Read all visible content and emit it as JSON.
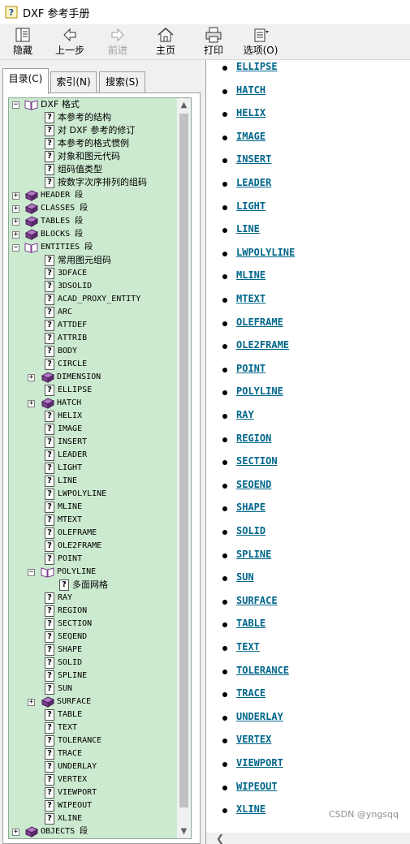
{
  "window": {
    "title": "DXF 参考手册"
  },
  "toolbar": {
    "hide": "隐藏",
    "back": "上一步",
    "forward": "前进",
    "home": "主页",
    "print": "打印",
    "options": "选项(O)"
  },
  "tabs": {
    "contents": "目录(C)",
    "index": "索引(N)",
    "search": "搜索(S)"
  },
  "tree": [
    {
      "label": "DXF 格式",
      "type": "book-open",
      "level": 0,
      "expander": "-"
    },
    {
      "label": "本参考的结构",
      "type": "page",
      "level": 1
    },
    {
      "label": "对 DXF 参考的修订",
      "type": "page",
      "level": 1
    },
    {
      "label": "本参考的格式惯例",
      "type": "page",
      "level": 1
    },
    {
      "label": "对象和图元代码",
      "type": "page",
      "level": 1
    },
    {
      "label": "组码值类型",
      "type": "page",
      "level": 1
    },
    {
      "label": "按数字次序排列的组码",
      "type": "page",
      "level": 1
    },
    {
      "label": "HEADER 段",
      "type": "book",
      "level": 0,
      "expander": "+"
    },
    {
      "label": "CLASSES 段",
      "type": "book",
      "level": 0,
      "expander": "+"
    },
    {
      "label": "TABLES 段",
      "type": "book",
      "level": 0,
      "expander": "+"
    },
    {
      "label": "BLOCKS 段",
      "type": "book",
      "level": 0,
      "expander": "+"
    },
    {
      "label": "ENTITIES 段",
      "type": "book-open",
      "level": 0,
      "expander": "-"
    },
    {
      "label": "常用图元组码",
      "type": "page",
      "level": 1
    },
    {
      "label": "3DFACE",
      "type": "page",
      "level": 1
    },
    {
      "label": "3DSOLID",
      "type": "page",
      "level": 1
    },
    {
      "label": "ACAD_PROXY_ENTITY",
      "type": "page",
      "level": 1
    },
    {
      "label": "ARC",
      "type": "page",
      "level": 1
    },
    {
      "label": "ATTDEF",
      "type": "page",
      "level": 1
    },
    {
      "label": "ATTRIB",
      "type": "page",
      "level": 1
    },
    {
      "label": "BODY",
      "type": "page",
      "level": 1
    },
    {
      "label": "CIRCLE",
      "type": "page",
      "level": 1
    },
    {
      "label": "DIMENSION",
      "type": "book",
      "level": 1,
      "expander": "+"
    },
    {
      "label": "ELLIPSE",
      "type": "page",
      "level": 1
    },
    {
      "label": "HATCH",
      "type": "book",
      "level": 1,
      "expander": "+"
    },
    {
      "label": "HELIX",
      "type": "page",
      "level": 1
    },
    {
      "label": "IMAGE",
      "type": "page",
      "level": 1
    },
    {
      "label": "INSERT",
      "type": "page",
      "level": 1
    },
    {
      "label": "LEADER",
      "type": "page",
      "level": 1
    },
    {
      "label": "LIGHT",
      "type": "page",
      "level": 1
    },
    {
      "label": "LINE",
      "type": "page",
      "level": 1
    },
    {
      "label": "LWPOLYLINE",
      "type": "page",
      "level": 1
    },
    {
      "label": "MLINE",
      "type": "page",
      "level": 1
    },
    {
      "label": "MTEXT",
      "type": "page",
      "level": 1
    },
    {
      "label": "OLEFRAME",
      "type": "page",
      "level": 1
    },
    {
      "label": "OLE2FRAME",
      "type": "page",
      "level": 1
    },
    {
      "label": "POINT",
      "type": "page",
      "level": 1
    },
    {
      "label": "POLYLINE",
      "type": "book-open",
      "level": 1,
      "expander": "-"
    },
    {
      "label": "多面网格",
      "type": "page",
      "level": 2
    },
    {
      "label": "RAY",
      "type": "page",
      "level": 1
    },
    {
      "label": "REGION",
      "type": "page",
      "level": 1
    },
    {
      "label": "SECTION",
      "type": "page",
      "level": 1
    },
    {
      "label": "SEQEND",
      "type": "page",
      "level": 1
    },
    {
      "label": "SHAPE",
      "type": "page",
      "level": 1
    },
    {
      "label": "SOLID",
      "type": "page",
      "level": 1
    },
    {
      "label": "SPLINE",
      "type": "page",
      "level": 1
    },
    {
      "label": "SUN",
      "type": "page",
      "level": 1
    },
    {
      "label": "SURFACE",
      "type": "book",
      "level": 1,
      "expander": "+"
    },
    {
      "label": "TABLE",
      "type": "page",
      "level": 1
    },
    {
      "label": "TEXT",
      "type": "page",
      "level": 1
    },
    {
      "label": "TOLERANCE",
      "type": "page",
      "level": 1
    },
    {
      "label": "TRACE",
      "type": "page",
      "level": 1
    },
    {
      "label": "UNDERLAY",
      "type": "page",
      "level": 1
    },
    {
      "label": "VERTEX",
      "type": "page",
      "level": 1
    },
    {
      "label": "VIEWPORT",
      "type": "page",
      "level": 1
    },
    {
      "label": "WIPEOUT",
      "type": "page",
      "level": 1
    },
    {
      "label": "XLINE",
      "type": "page",
      "level": 1
    },
    {
      "label": "OBJECTS 段",
      "type": "book",
      "level": 0,
      "expander": "+"
    }
  ],
  "links": [
    "ELLIPSE",
    "HATCH",
    "HELIX",
    "IMAGE",
    "INSERT",
    "LEADER",
    "LIGHT",
    "LINE",
    "LWPOLYLINE",
    "MLINE",
    "MTEXT",
    "OLEFRAME",
    "OLE2FRAME",
    "POINT",
    "POLYLINE",
    "RAY",
    "REGION",
    "SECTION",
    "SEQEND",
    "SHAPE",
    "SOLID",
    "SPLINE",
    "SUN",
    "SURFACE",
    "TABLE",
    "TEXT",
    "TOLERANCE",
    "TRACE",
    "UNDERLAY",
    "VERTEX",
    "VIEWPORT",
    "WIPEOUT",
    "XLINE"
  ],
  "watermark": "CSDN @yngsqq",
  "colors": {
    "tree_bg": "#ccead0",
    "link": "#00668a",
    "book": "#7b3f8c"
  }
}
